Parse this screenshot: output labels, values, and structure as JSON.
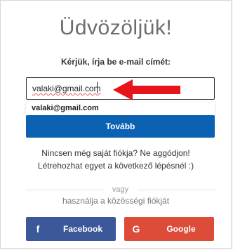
{
  "header": {
    "title": "Üdvözöljük!"
  },
  "form": {
    "prompt": "Kérjük, írja be e-mail címét:",
    "email_value": "valaki@gmail.com",
    "autocomplete_suggestion": "valaki@gmail.com",
    "next_label": "Tovább"
  },
  "info": {
    "line1": "Nincsen még saját fiókja? Ne aggódjon!",
    "line2": "Létrehozhat egyet a következő lépésnél :)"
  },
  "social": {
    "divider_text": "vagy",
    "prompt": "használja a közösségi fiókját",
    "facebook_label": "Facebook",
    "facebook_icon": "f",
    "google_label": "Google",
    "google_icon": "G"
  },
  "colors": {
    "primary": "#0b62b3",
    "facebook": "#3b5998",
    "google": "#dd4b39",
    "annotation_arrow": "#e8141c"
  }
}
